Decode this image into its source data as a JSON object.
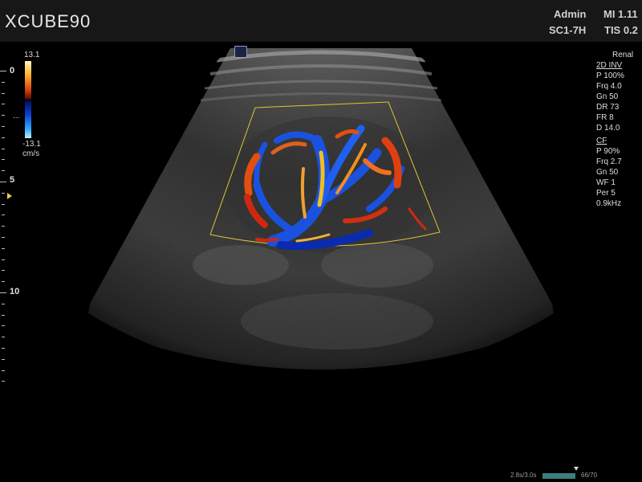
{
  "header": {
    "brand": "XCUBE90",
    "user": "Admin",
    "probe": "SC1-7H",
    "mi": "MI 1.11",
    "tis": "TIS 0.2"
  },
  "depth_scale": {
    "labels": [
      "0",
      "5",
      "10"
    ],
    "unit_note": "cm"
  },
  "color_bar": {
    "max": "13.1",
    "min": "-13.1",
    "unit": "cm/s",
    "baseline_marker": "..."
  },
  "preset": "Renal",
  "mode_2d": {
    "title": "2D INV",
    "params": [
      "P 100%",
      "Frq 4.0",
      "Gn 50",
      "DR 73",
      "FR 8",
      "D 14.0"
    ]
  },
  "mode_cf": {
    "title": "CF",
    "params": [
      "P 90%",
      "Frq 2.7",
      "Gn 50",
      "WF 1",
      "Per 5",
      "0.9kHz"
    ]
  },
  "cine": {
    "time": "2.8s/3.0s",
    "frames": "66/70",
    "progress": 0.94
  },
  "colors": {
    "header_bg": "#171717",
    "roi_box": "#d8c832",
    "flow_red": "#d02810",
    "flow_blue": "#1a52e0"
  }
}
